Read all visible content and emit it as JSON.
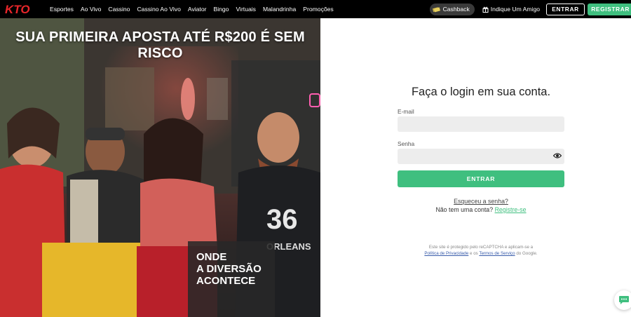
{
  "brand": {
    "logo_text": "KTO",
    "accent": "#3fbf7f",
    "logo_color": "#e8262a"
  },
  "nav": {
    "items": [
      {
        "label": "Esportes"
      },
      {
        "label": "Ao Vivo"
      },
      {
        "label": "Cassino"
      },
      {
        "label": "Cassino Ao Vivo"
      },
      {
        "label": "Aviator"
      },
      {
        "label": "Bingo"
      },
      {
        "label": "Virtuais"
      },
      {
        "label": "Malandrinha"
      },
      {
        "label": "Promoções"
      }
    ],
    "cashback_label": "Cashback",
    "cashback_icon": "cash-icon",
    "refer_label": "Indique Um Amigo",
    "refer_icon": "gift-icon",
    "login_label": "ENTRAR",
    "register_label": "REGISTRAR"
  },
  "hero": {
    "headline": "SUA PRIMEIRA APOSTA ATÉ R$200 É SEM RISCO",
    "tagline_line1": "ONDE",
    "tagline_line2": "A DIVERSÃO",
    "tagline_line3": "ACONTECE",
    "jersey_number": "36",
    "jersey_text": "ORLEANS"
  },
  "login": {
    "title": "Faça o login em sua conta.",
    "email_label": "E-mail",
    "email_value": "",
    "password_label": "Senha",
    "password_value": "",
    "password_icon": "eye-icon",
    "submit_label": "ENTRAR",
    "forgot_label": "Esqueceu a senha?",
    "no_account_text": "Não tem uma conta?",
    "register_link": "Registre-se",
    "recaptcha_text_1": "Este site é protegido pelo reCAPTCHA e aplicam-se a",
    "privacy_link": "Política de Privacidade",
    "recaptcha_and": "e os",
    "terms_link": "Termos de Serviço",
    "recaptcha_google": "do Google."
  },
  "chat": {
    "icon": "chat-icon"
  }
}
